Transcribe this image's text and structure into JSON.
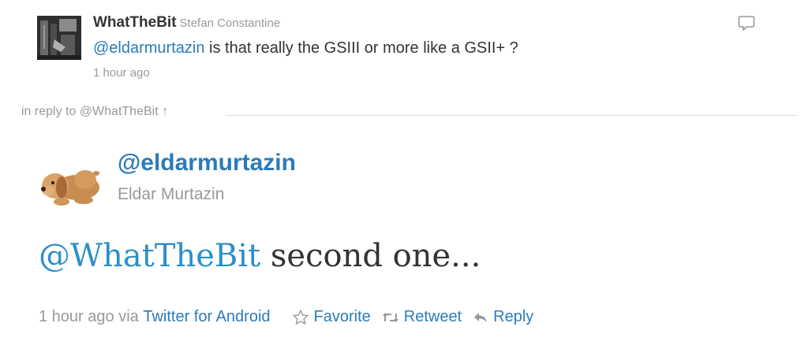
{
  "parent_tweet": {
    "display_name": "WhatTheBit",
    "username": "Stefan Constantine",
    "mention": "@eldarmurtazin",
    "text": " is that really the GSIII or more like a GSII+ ?",
    "timestamp": "1 hour ago",
    "reply_icon": "speech-bubble-icon"
  },
  "in_reply_to": {
    "label": "in reply to @WhatTheBit",
    "arrow": "↑"
  },
  "main_tweet": {
    "username": "@eldarmurtazin",
    "full_name": "Eldar Murtazin",
    "mention": "@WhatTheBit",
    "text": " second one...",
    "timestamp": "1 hour ago",
    "via_label": "via",
    "client": "Twitter for Android",
    "actions": {
      "favorite": "Favorite",
      "retweet": "Retweet",
      "reply": "Reply"
    }
  },
  "colors": {
    "link": "#2b7bb9",
    "muted": "#999999",
    "text": "#333333"
  }
}
